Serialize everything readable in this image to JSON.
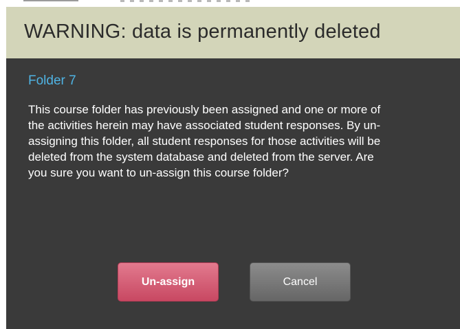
{
  "dialog": {
    "title": "WARNING: data is permanently deleted",
    "folder_name": "Folder 7",
    "message": "This course folder has previously been assigned and one or more of the activities herein may have associated student responses. By un-assigning this folder, all student responses for those activities will be deleted from the system database and deleted from the server. Are you sure you want to un-assign this course folder?",
    "buttons": {
      "unassign_label": "Un-assign",
      "cancel_label": "Cancel"
    }
  },
  "colors": {
    "header_background": "#d3d5b9",
    "dialog_background": "#3a3a3a",
    "folder_name_color": "#4fb3e3",
    "unassign_button": "#d35a73",
    "cancel_button": "#777777"
  }
}
